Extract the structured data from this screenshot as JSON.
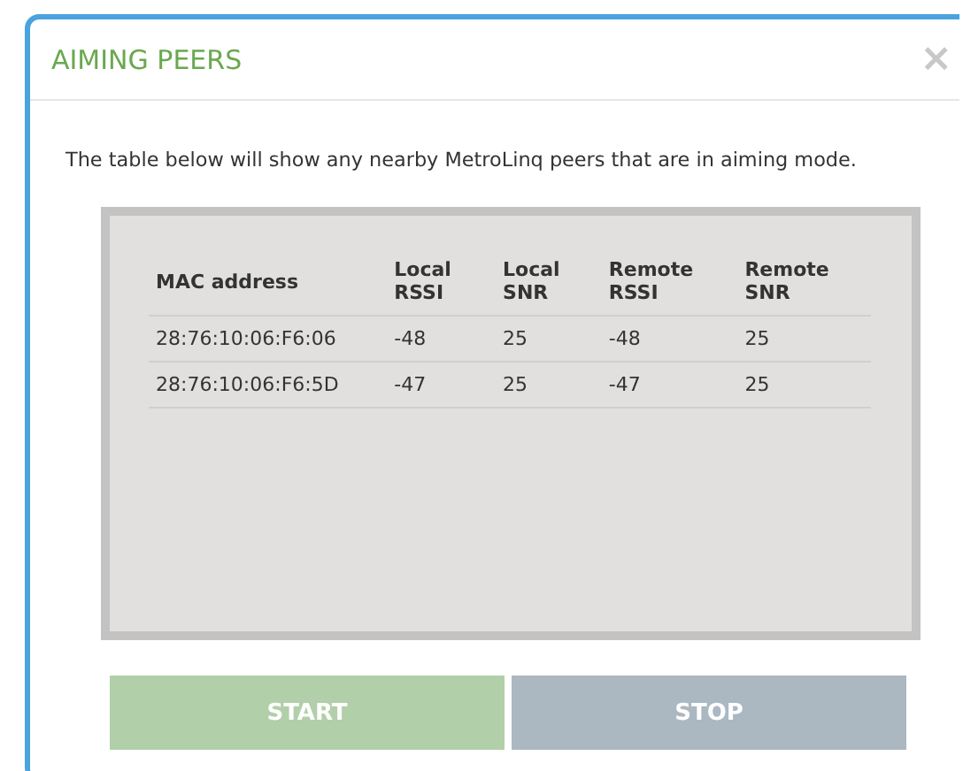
{
  "dialog": {
    "title": "AIMING PEERS",
    "close": "×",
    "description": "The table below will show any nearby MetroLinq peers that are in aiming mode."
  },
  "table": {
    "columns": [
      "MAC address",
      "Local RSSI",
      "Local SNR",
      "Remote RSSI",
      "Remote SNR"
    ],
    "rows": [
      [
        "28:76:10:06:F6:06",
        "-48",
        "25",
        "-48",
        "25"
      ],
      [
        "28:76:10:06:F6:5D",
        "-47",
        "25",
        "-47",
        "25"
      ]
    ]
  },
  "buttons": [
    {
      "label": "START",
      "kind": "start"
    },
    {
      "label": "STOP",
      "kind": "stop"
    }
  ]
}
